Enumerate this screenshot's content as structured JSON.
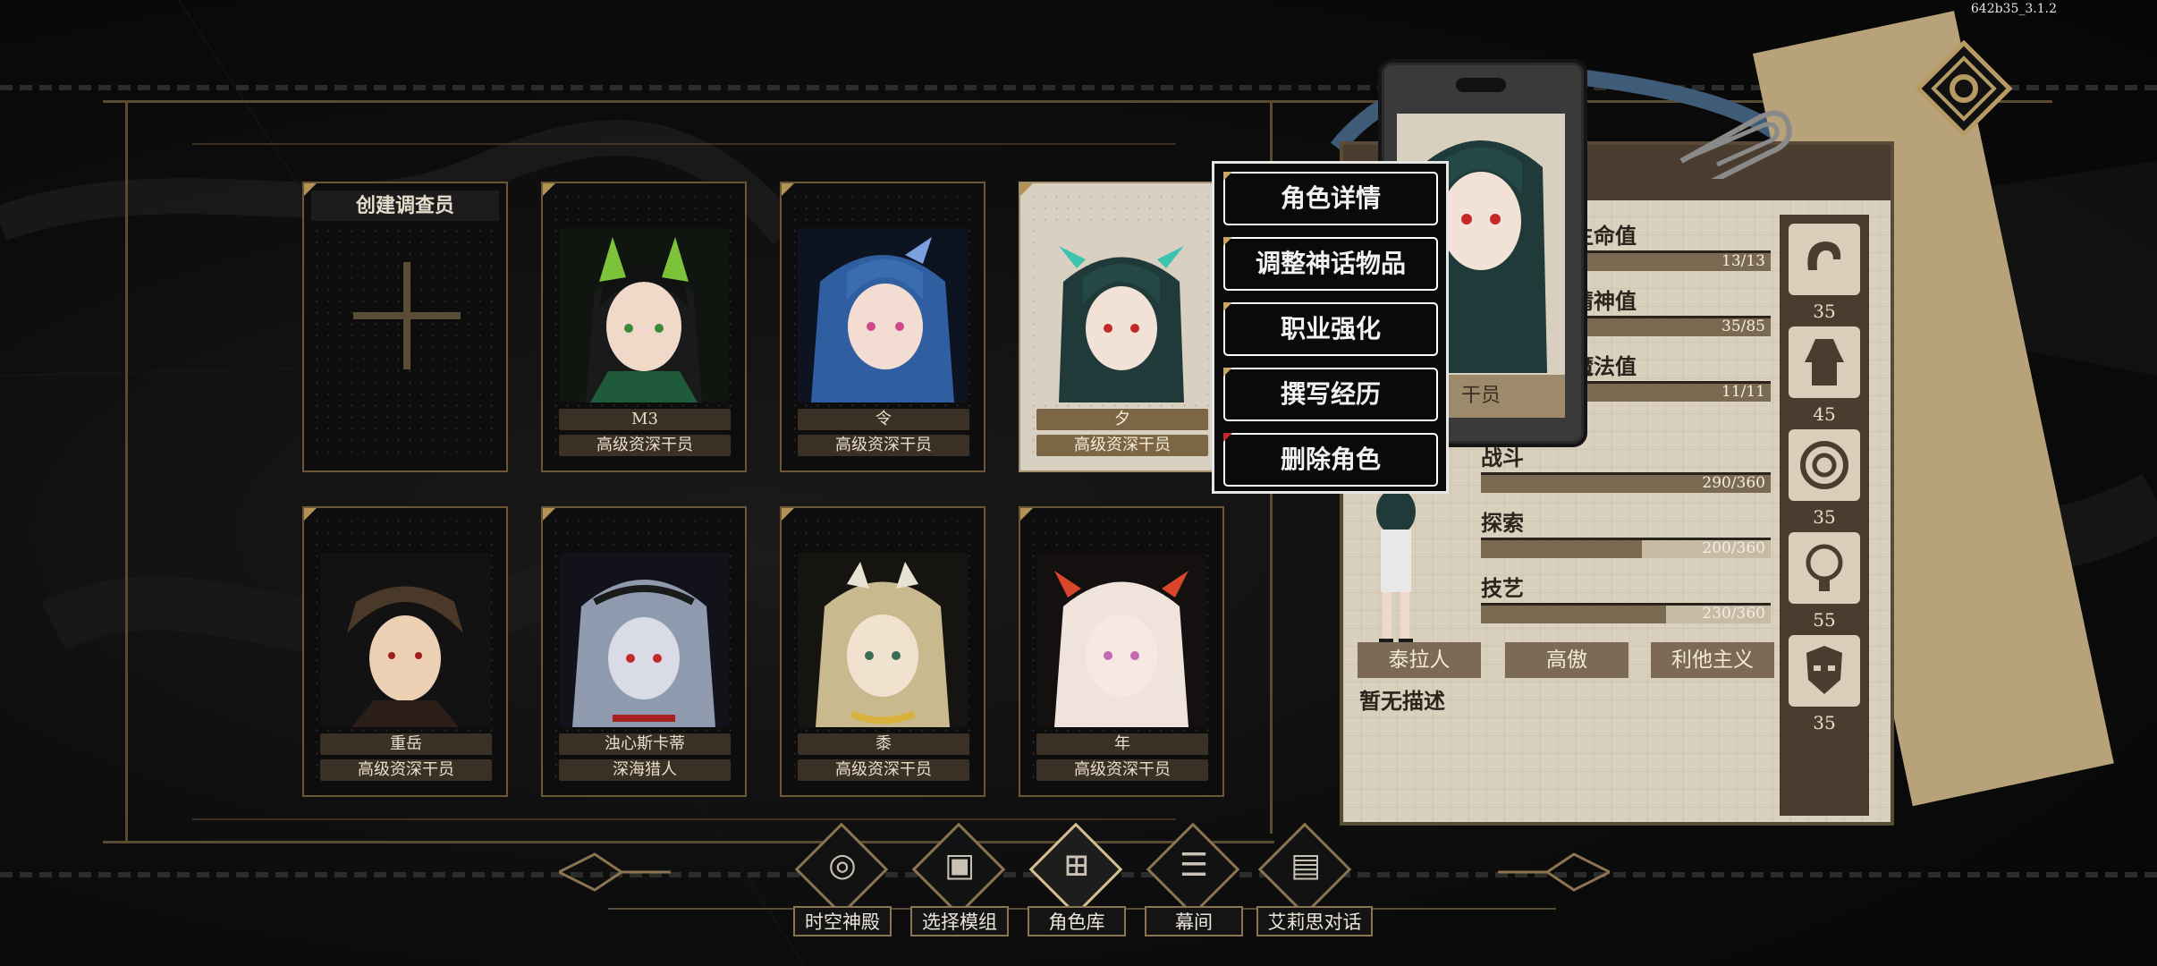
{
  "version": "642b35_3.1.2",
  "roster": {
    "create_label": "创建调查员",
    "cards": [
      {
        "name": "M3",
        "rank": "高级资深干员"
      },
      {
        "name": "令",
        "rank": "高级资深干员"
      },
      {
        "name": "夕",
        "rank": "高级资深干员",
        "selected": true
      },
      {
        "name": "重岳",
        "rank": "高级资深干员"
      },
      {
        "name": "浊心斯卡蒂",
        "rank": "深海猎人"
      },
      {
        "name": "黍",
        "rank": "高级资深干员"
      },
      {
        "name": "年",
        "rank": "高级资深干员"
      }
    ]
  },
  "context_menu": {
    "items": [
      "角色详情",
      "调整神话物品",
      "职业强化",
      "撰写经历",
      "删除角色"
    ]
  },
  "detail": {
    "tag_fragment": "干员",
    "stats": [
      {
        "label": "生命值",
        "value": "13/13",
        "fraction": 1.0
      },
      {
        "label": "精神值",
        "value": "35/85",
        "fraction": 1.0
      },
      {
        "label": "魔法值",
        "value": "11/11",
        "fraction": 1.0
      }
    ],
    "skills": [
      {
        "label": "战斗",
        "value": "290/360",
        "fraction": 1.0
      },
      {
        "label": "探索",
        "value": "200/360",
        "fraction": 0.556
      },
      {
        "label": "技艺",
        "value": "230/360",
        "fraction": 0.639
      }
    ],
    "traits": [
      "泰拉人",
      "高傲",
      "利他主义"
    ],
    "description": "暂无描述",
    "attributes": [
      {
        "icon": "arm-icon",
        "value": "35"
      },
      {
        "icon": "body-icon",
        "value": "45"
      },
      {
        "icon": "swirl-icon",
        "value": "35"
      },
      {
        "icon": "mind-icon",
        "value": "55"
      },
      {
        "icon": "mask-icon",
        "value": "35"
      }
    ]
  },
  "nav": {
    "items": [
      {
        "label": "时空神殿",
        "icon": "temple-icon"
      },
      {
        "label": "选择模组",
        "icon": "module-icon"
      },
      {
        "label": "角色库",
        "icon": "character-library-icon",
        "active": true
      },
      {
        "label": "幕间",
        "icon": "interlude-icon"
      },
      {
        "label": "艾莉思对话",
        "icon": "dialogue-icon"
      }
    ]
  },
  "colors": {
    "gold": "#8a7550",
    "paper": "#d9d0bd",
    "danger": "#c42a2a"
  }
}
